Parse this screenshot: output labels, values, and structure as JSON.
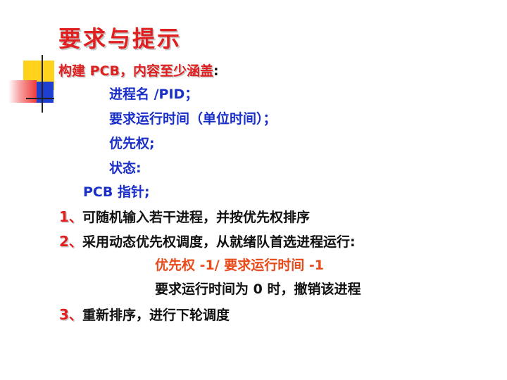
{
  "title": "要求与提示",
  "line1": {
    "main": "构建 PCB，内容至少涵盖",
    "colon": ":"
  },
  "items": [
    "进程名 /PID；",
    "要求运行时间（单位时间）；",
    "优先权;",
    "状态:"
  ],
  "pcb_pointer": "PCB 指针;",
  "steps": [
    {
      "num": "1",
      "sep": "、",
      "text": "可随机输入若干进程，并按优先权排序"
    },
    {
      "num": "2",
      "sep": "、",
      "text": "采用动态优先权调度，从就绪队首选进程运行:"
    },
    {
      "num": "3",
      "sep": "、",
      "text": "重新排序，进行下轮调度"
    }
  ],
  "rule1": "优先权 -1/ 要求运行时间 -1",
  "rule2": "要求运行时间为 0 时，撤销该进程",
  "colors": {
    "title": "#e02020",
    "items": "#1a2fc8",
    "rule": "#e84a1a",
    "text": "#111111"
  }
}
